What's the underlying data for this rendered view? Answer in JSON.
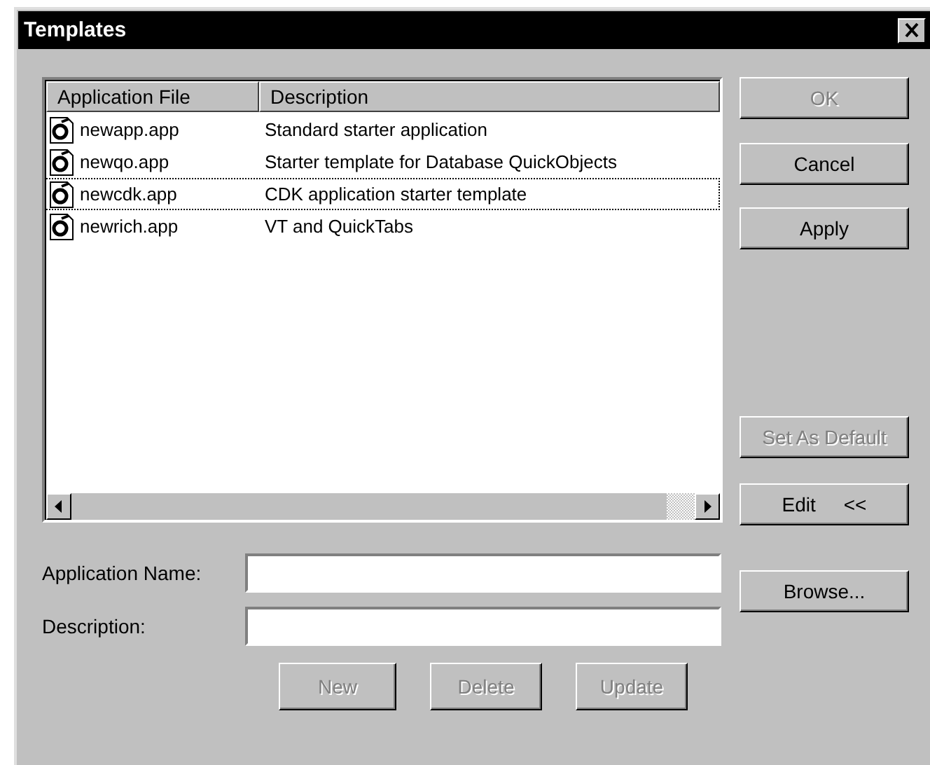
{
  "window": {
    "title": "Templates"
  },
  "table": {
    "columns": [
      "Application File",
      "Description"
    ],
    "rows": [
      {
        "file": "newapp.app",
        "description": "Standard starter application",
        "focused": false
      },
      {
        "file": "newqo.app",
        "description": "Starter template for Database QuickObjects",
        "focused": false
      },
      {
        "file": "newcdk.app",
        "description": "CDK application starter template",
        "focused": true
      },
      {
        "file": "newrich.app",
        "description": "VT and QuickTabs",
        "focused": false
      }
    ]
  },
  "side_buttons": [
    {
      "label": "OK",
      "disabled": true
    },
    {
      "label": "Cancel",
      "disabled": false
    },
    {
      "label": "Apply",
      "disabled": false
    },
    {
      "label": "Set As Default",
      "disabled": true
    },
    {
      "label": "Edit",
      "suffix": "<<",
      "disabled": false
    },
    {
      "label": "Browse...",
      "disabled": false
    }
  ],
  "fields": [
    {
      "label": "Application Name:"
    },
    {
      "label": "Description:"
    }
  ],
  "bottom_buttons": [
    {
      "label": "New",
      "disabled": true
    },
    {
      "label": "Delete",
      "disabled": true
    },
    {
      "label": "Update",
      "disabled": true
    }
  ]
}
